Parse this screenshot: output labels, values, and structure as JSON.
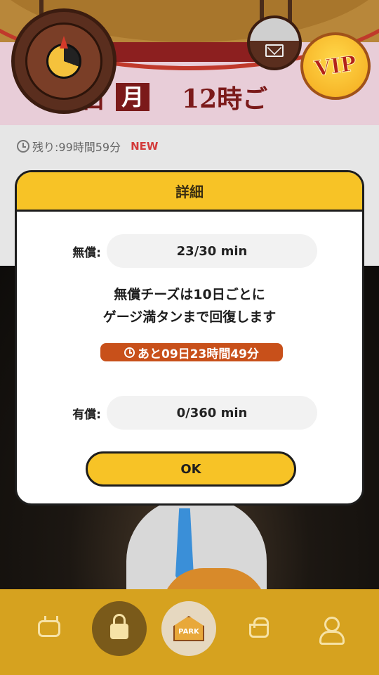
{
  "header": {
    "banner_day_suffix": "1日",
    "banner_weekday": "月",
    "banner_time": "12時ご",
    "vip_label": "VIP"
  },
  "episode": {
    "remaining": "残り:99時間59分",
    "new_badge": "NEW"
  },
  "modal": {
    "title": "詳細",
    "free_label": "無償:",
    "free_value": "23/30 min",
    "description_line1": "無償チーズは10日ごとに",
    "description_line2": "ゲージ満タンまで回復します",
    "countdown": "あと09日23時間49分",
    "paid_label": "有償:",
    "paid_value": "0/360 min",
    "ok_label": "OK"
  },
  "bottom_nav": {
    "park_label": "PARK"
  },
  "icons": {
    "clock_widget": "clock-icon",
    "mail": "mail-icon",
    "vip": "vip-badge-icon",
    "remaining": "clock-icon",
    "countdown": "clock-icon",
    "nav_tv": "tv-icon",
    "nav_lock": "lock-icon",
    "nav_park": "park-icon",
    "nav_basket": "basket-icon",
    "nav_user": "user-icon"
  },
  "colors": {
    "accent_yellow": "#f7c326",
    "countdown_orange": "#c8501a",
    "nav_bar": "#d6a21f",
    "new_red": "#d33a3a"
  }
}
